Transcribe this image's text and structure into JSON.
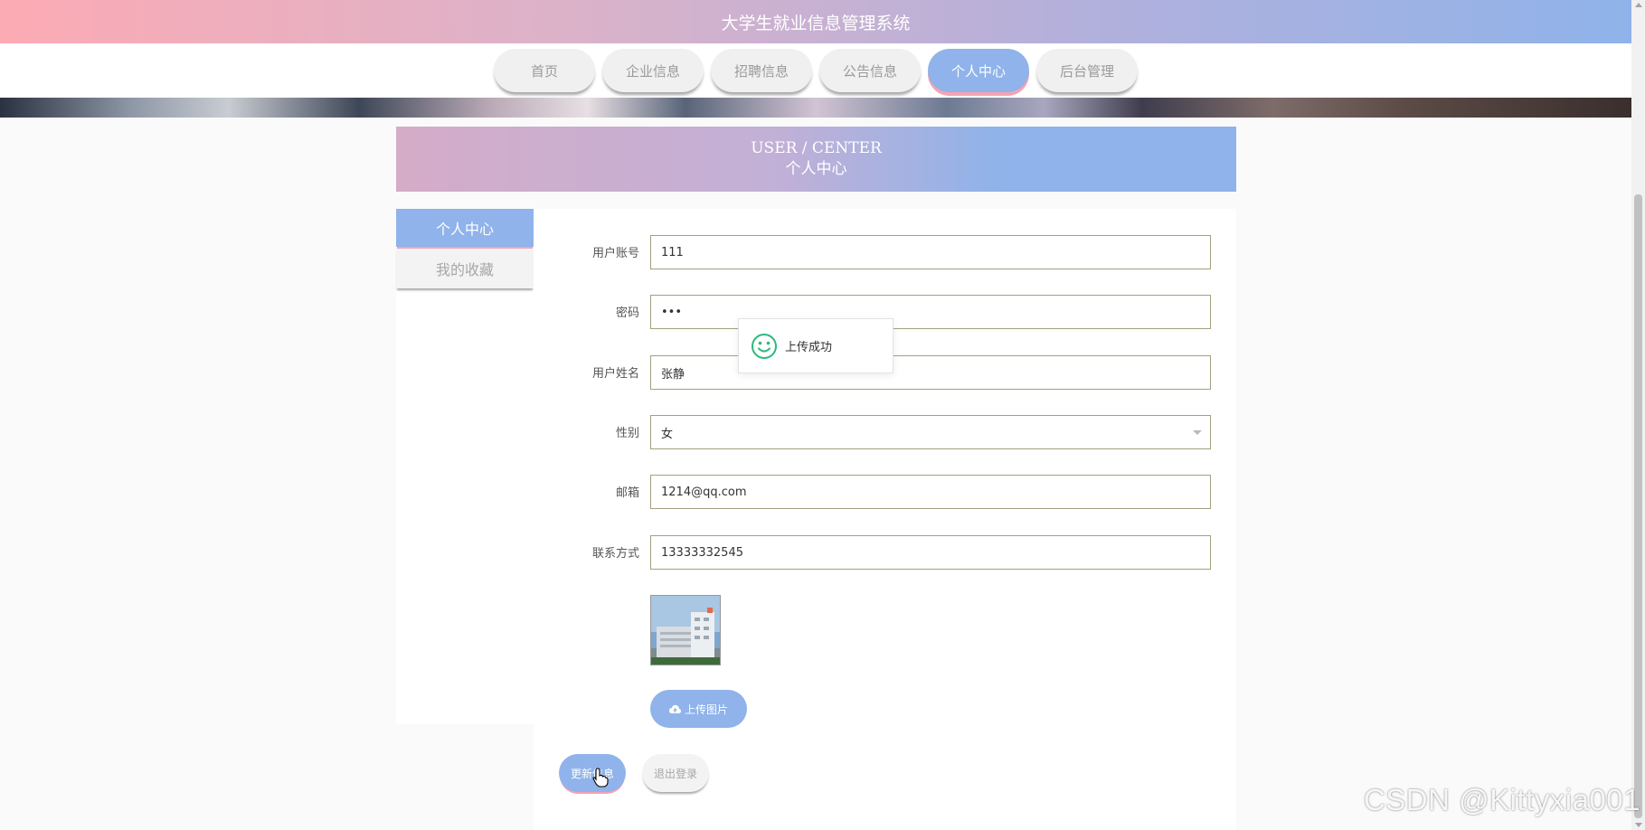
{
  "header": {
    "title": "大学生就业信息管理系统"
  },
  "nav": {
    "items": [
      {
        "label": "首页"
      },
      {
        "label": "企业信息"
      },
      {
        "label": "招聘信息"
      },
      {
        "label": "公告信息"
      },
      {
        "label": "个人中心",
        "active": true
      },
      {
        "label": "后台管理"
      }
    ]
  },
  "section": {
    "title_en": "USER / CENTER",
    "title_zh": "个人中心"
  },
  "sidebar": {
    "items": [
      {
        "label": "个人中心",
        "active": true
      },
      {
        "label": "我的收藏"
      }
    ]
  },
  "form": {
    "account": {
      "label": "用户账号",
      "value": "111"
    },
    "password": {
      "label": "密码",
      "value": "•••"
    },
    "name": {
      "label": "用户姓名",
      "value": "张静"
    },
    "gender": {
      "label": "性别",
      "value": "女"
    },
    "email": {
      "label": "邮箱",
      "value": "1214@qq.com"
    },
    "phone": {
      "label": "联系方式",
      "value": "13333332545"
    },
    "upload_label": "上传图片"
  },
  "actions": {
    "update_label": "更新信息",
    "logout_label": "退出登录"
  },
  "toast": {
    "message": "上传成功",
    "icon": "smile-icon"
  },
  "watermark": "CSDN @Kittyxia001",
  "colors": {
    "accent": "#8fb3ea",
    "pink": "#f5a3b3",
    "success": "#2db87d"
  }
}
